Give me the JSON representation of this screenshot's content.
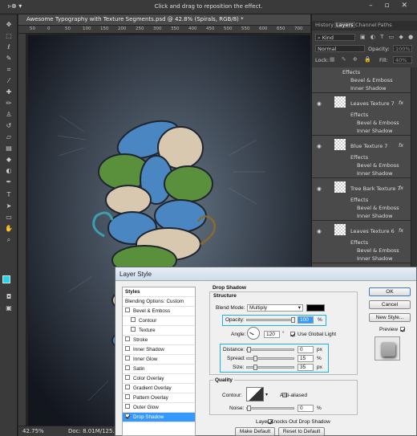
{
  "options_bar": {
    "hint": "Click and drag to reposition the effect.",
    "tool_glyph": "▹⊕ ▾",
    "window_buttons": "–  ▫  ✕"
  },
  "document": {
    "tab_title": "Awesome Typography with Texture Segments.psd @ 42.8% (Spirals, RGB/8) *",
    "ruler_ticks": [
      "50",
      "0",
      "50",
      "100",
      "150",
      "200",
      "250",
      "300",
      "350",
      "400",
      "450",
      "500",
      "550",
      "600",
      "650",
      "700"
    ],
    "zoom": "42.75%",
    "doc_info": "Doc: 8.01M/125.8M"
  },
  "panels": {
    "tabs": [
      "History",
      "Layers",
      "Channel",
      "Paths"
    ],
    "kind_label": "Kind",
    "blend_mode": "Normal",
    "opacity_label": "Opacity:",
    "opacity_value": "100%",
    "lock_label": "Lock:",
    "fill_label": "Fill:",
    "fill_value": "40%",
    "effects_label": "Effects",
    "bevel_label": "Bevel & Emboss",
    "inner_shadow_label": "Inner Shadow",
    "fx_label": "fx",
    "layers": [
      {
        "name": "Leaves Texture 7"
      },
      {
        "name": "Blue Texture 7"
      },
      {
        "name": "Tree Bark Texture 7"
      },
      {
        "name": "Leaves Texture 6"
      }
    ]
  },
  "dialog": {
    "title": "Layer Style",
    "styles_header": "Styles",
    "blending_options": "Blending Options: Custom",
    "style_items": [
      {
        "label": "Bevel & Emboss",
        "checked": false
      },
      {
        "label": "Contour",
        "checked": false
      },
      {
        "label": "Texture",
        "checked": false
      },
      {
        "label": "Stroke",
        "checked": false
      },
      {
        "label": "Inner Shadow",
        "checked": false
      },
      {
        "label": "Inner Glow",
        "checked": false
      },
      {
        "label": "Satin",
        "checked": false
      },
      {
        "label": "Color Overlay",
        "checked": false
      },
      {
        "label": "Gradient Overlay",
        "checked": false
      },
      {
        "label": "Pattern Overlay",
        "checked": false
      },
      {
        "label": "Outer Glow",
        "checked": false
      },
      {
        "label": "Drop Shadow",
        "checked": true
      }
    ],
    "section_title": "Drop Shadow",
    "structure_title": "Structure",
    "blend_mode_label": "Blend Mode:",
    "blend_mode_value": "Multiply",
    "shadow_color": "#000000",
    "opacity_label": "Opacity:",
    "opacity_value": "100",
    "opacity_level": 1.0,
    "angle_label": "Angle:",
    "angle_value": "120",
    "angle_unit": "°",
    "use_global_light": "Use Global Light",
    "distance_label": "Distance:",
    "distance_value": "0",
    "distance_level": 0.0,
    "spread_label": "Spread:",
    "spread_value": "15",
    "spread_level": 0.15,
    "size_label": "Size:",
    "size_value": "35",
    "size_level": 0.14,
    "px_unit": "px",
    "pct_unit": "%",
    "quality_title": "Quality",
    "contour_label": "Contour:",
    "anti_aliased": "Anti-aliased",
    "noise_label": "Noise:",
    "noise_value": "0",
    "noise_level": 0.0,
    "layer_knocks_out": "Layer Knocks Out Drop Shadow",
    "make_default": "Make Default",
    "reset_default": "Reset to Default",
    "ok": "OK",
    "cancel": "Cancel",
    "new_style": "New Style...",
    "preview": "Preview",
    "highlight_color": "#19b4e6"
  }
}
